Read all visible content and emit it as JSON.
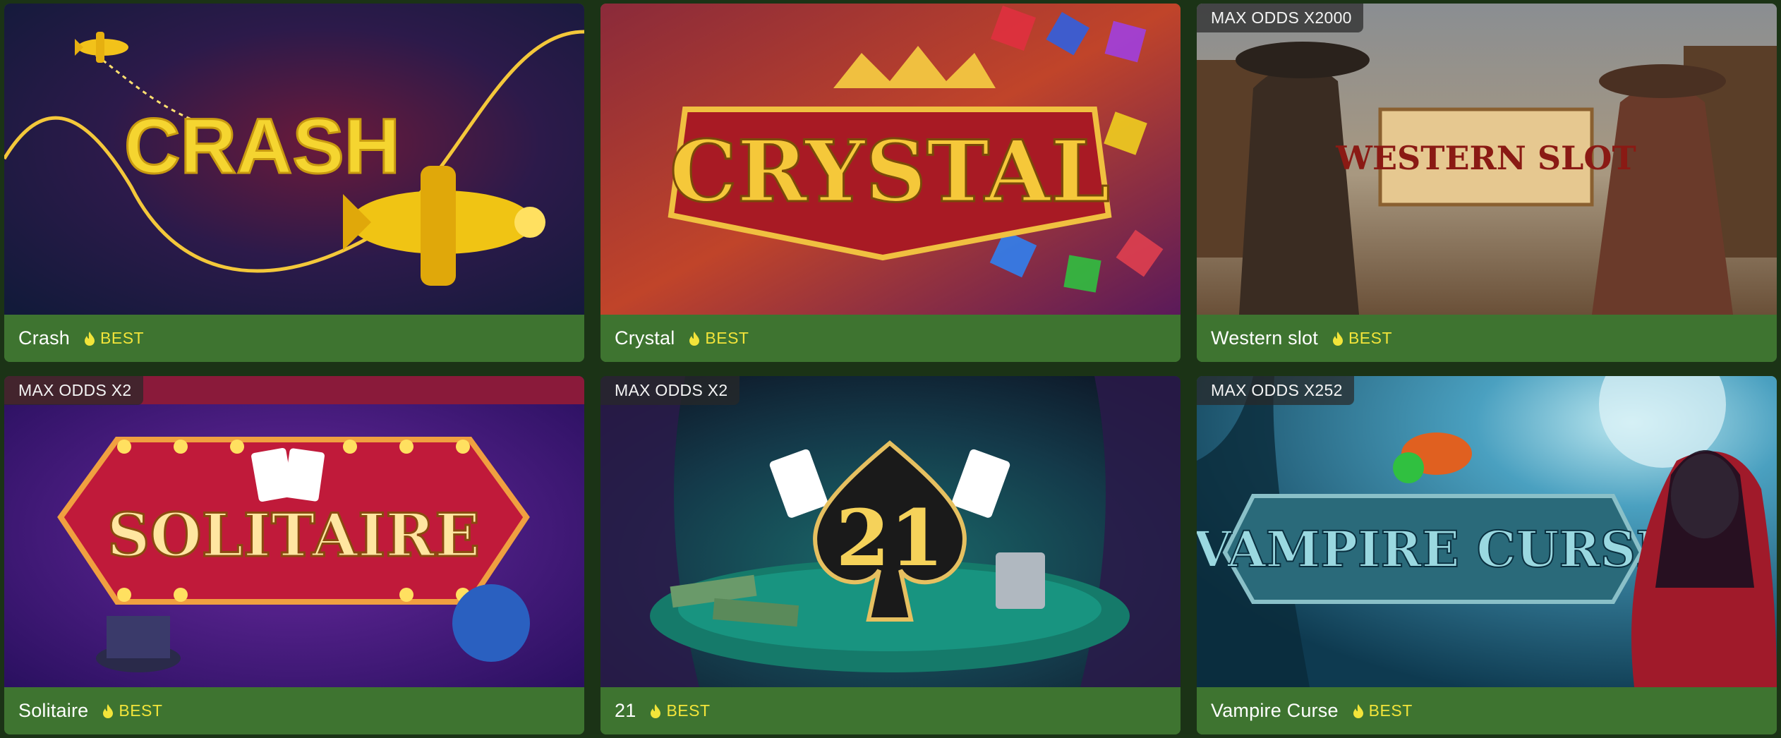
{
  "colors": {
    "card_bg": "#3e7430",
    "page_bg": "#1b3316",
    "badge_text": "#f2e43a"
  },
  "games": [
    {
      "title": "Crash",
      "badge": "BEST",
      "badge_icon": "flame-icon",
      "max_odds": "",
      "logo_text": "CRASH"
    },
    {
      "title": "Crystal",
      "badge": "BEST",
      "badge_icon": "flame-icon",
      "max_odds": "",
      "logo_text": "CRYSTAL"
    },
    {
      "title": "Western slot",
      "badge": "BEST",
      "badge_icon": "flame-icon",
      "max_odds": "MAX ODDS X2000",
      "logo_text": "WESTERN SLOT"
    },
    {
      "title": "Solitaire",
      "badge": "BEST",
      "badge_icon": "flame-icon",
      "max_odds": "MAX ODDS X2",
      "logo_text": "SOLITAIRE"
    },
    {
      "title": "21",
      "badge": "BEST",
      "badge_icon": "flame-icon",
      "max_odds": "MAX ODDS X2",
      "logo_text": "21"
    },
    {
      "title": "Vampire Curse",
      "badge": "BEST",
      "badge_icon": "flame-icon",
      "max_odds": "MAX ODDS X252",
      "logo_text": "VAMPIRE CURSE"
    }
  ]
}
